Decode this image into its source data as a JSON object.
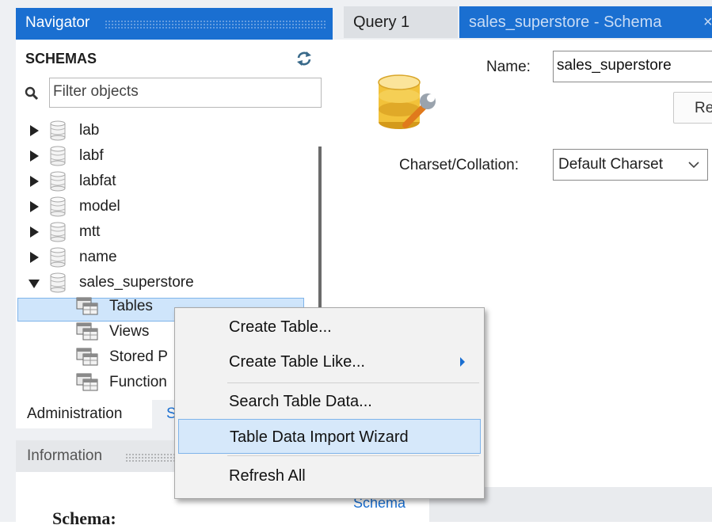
{
  "navigator": {
    "title": "Navigator",
    "schemas_label": "SCHEMAS",
    "filter_placeholder": "Filter objects",
    "schemas": [
      {
        "name": "lab",
        "expanded": false
      },
      {
        "name": "labf",
        "expanded": false
      },
      {
        "name": "labfat",
        "expanded": false
      },
      {
        "name": "model",
        "expanded": false
      },
      {
        "name": "mtt",
        "expanded": false
      },
      {
        "name": "name",
        "expanded": false
      },
      {
        "name": "sales_superstore",
        "expanded": true
      }
    ],
    "children": [
      {
        "label": "Tables",
        "selected": true
      },
      {
        "label": "Views"
      },
      {
        "label": "Stored P"
      },
      {
        "label": "Function"
      }
    ]
  },
  "bottom_tabs": {
    "administration": "Administration",
    "schemas_fragment": "S"
  },
  "information": {
    "title": "Information",
    "schema_heading": "Schema:"
  },
  "tabs": {
    "query": "Query 1",
    "schema": "sales_superstore - Schema",
    "close": "×"
  },
  "editor": {
    "name_label": "Name:",
    "name_value": "sales_superstore",
    "rename_fragment": "Re",
    "charset_label": "Charset/Collation:",
    "charset_value": "Default Charset",
    "bottom_tab": "Schema"
  },
  "context_menu": {
    "items": [
      {
        "label": "Create Table..."
      },
      {
        "label": "Create Table Like...",
        "submenu": true
      },
      {
        "label": "Search Table Data..."
      },
      {
        "label": "Table Data Import Wizard",
        "highlighted": true
      },
      {
        "label": "Refresh All"
      }
    ]
  },
  "colors": {
    "accent": "#1a6fd1",
    "selection": "#cfe5fb",
    "panel": "#eef0f3"
  }
}
